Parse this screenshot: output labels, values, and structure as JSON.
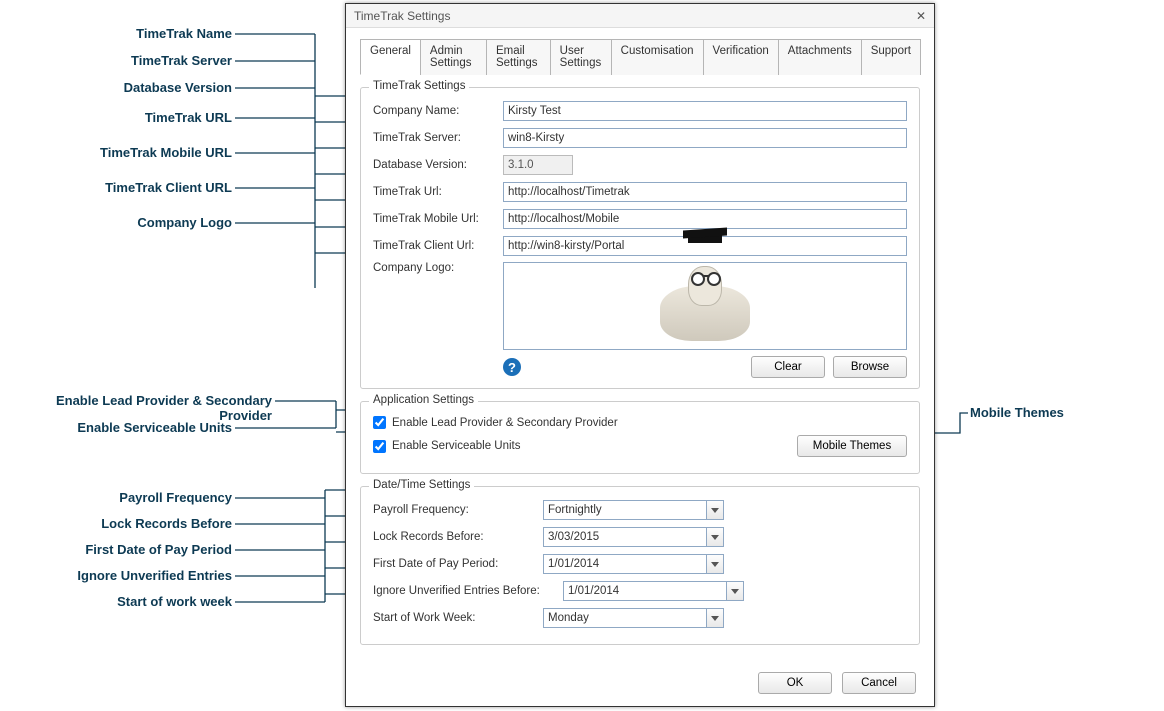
{
  "window": {
    "title": "TimeTrak Settings"
  },
  "tabs": [
    {
      "label": "General"
    },
    {
      "label": "Admin Settings"
    },
    {
      "label": "Email Settings"
    },
    {
      "label": "User Settings"
    },
    {
      "label": "Customisation"
    },
    {
      "label": "Verification"
    },
    {
      "label": "Attachments"
    },
    {
      "label": "Support"
    }
  ],
  "settings_group": {
    "legend": "TimeTrak Settings",
    "company_name_label": "Company Name:",
    "company_name_value": "Kirsty Test",
    "server_label": "TimeTrak Server:",
    "server_value": "win8-Kirsty",
    "db_version_label": "Database Version:",
    "db_version_value": "3.1.0",
    "url_label": "TimeTrak Url:",
    "url_value": "http://localhost/Timetrak",
    "mobile_url_label": "TimeTrak Mobile Url:",
    "mobile_url_value": "http://localhost/Mobile",
    "client_url_label": "TimeTrak Client Url:",
    "client_url_value": "http://win8-kirsty/Portal",
    "logo_label": "Company Logo:",
    "clear_label": "Clear",
    "browse_label": "Browse"
  },
  "app_group": {
    "legend": "Application Settings",
    "lead_provider_label": "Enable Lead Provider & Secondary Provider",
    "lead_provider_checked": true,
    "serviceable_label": "Enable Serviceable Units",
    "serviceable_checked": true,
    "mobile_themes_label": "Mobile Themes"
  },
  "dt_group": {
    "legend": "Date/Time Settings",
    "payroll_label": "Payroll Frequency:",
    "payroll_value": "Fortnightly",
    "lock_label": "Lock Records Before:",
    "lock_value": "3/03/2015",
    "first_pay_label": "First Date of Pay Period:",
    "first_pay_value": "1/01/2014",
    "ignore_label": "Ignore Unverified Entries Before:",
    "ignore_value": "1/01/2014",
    "sow_label": "Start of Work Week:",
    "sow_value": "Monday"
  },
  "footer": {
    "ok_label": "OK",
    "cancel_label": "Cancel"
  },
  "callouts": {
    "name": "TimeTrak Name",
    "server": "TimeTrak Server",
    "db": "Database Version",
    "url": "TimeTrak URL",
    "mobile_url": "TimeTrak Mobile URL",
    "client_url": "TimeTrak Client URL",
    "logo": "Company Logo",
    "lead": "Enable Lead Provider & Secondary Provider",
    "serviceable": "Enable Serviceable Units",
    "payroll": "Payroll Frequency",
    "lock": "Lock Records Before",
    "first_pay": "First Date of Pay Period",
    "ignore": "Ignore Unverified Entries",
    "sow": "Start of work week",
    "mobile_themes": "Mobile Themes"
  }
}
